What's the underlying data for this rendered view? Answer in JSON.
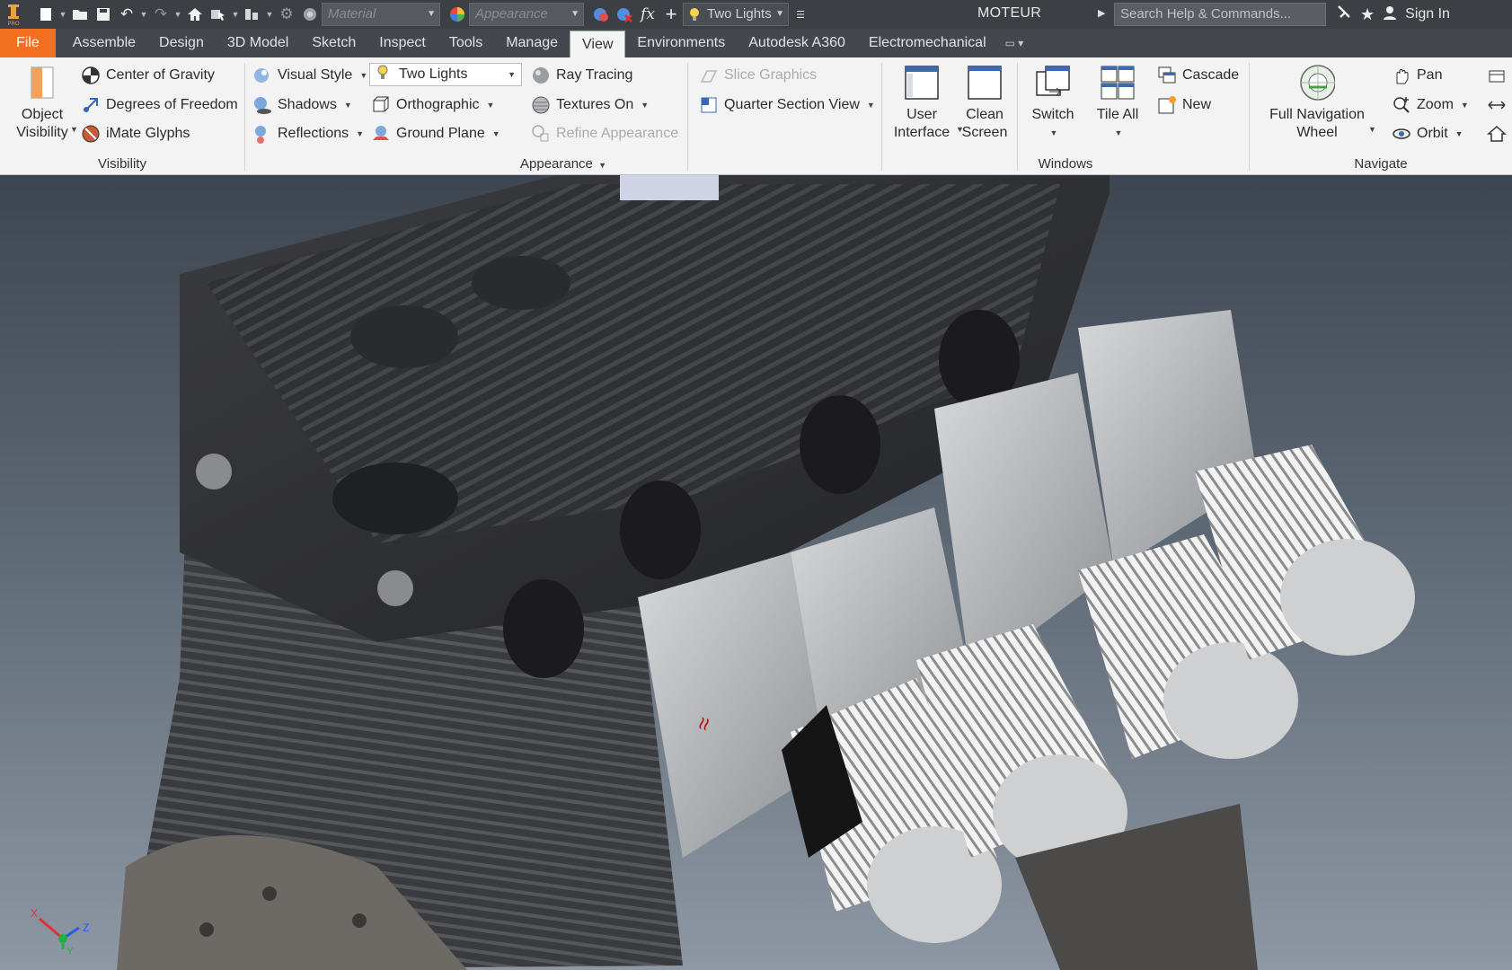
{
  "quick_access": {
    "material_placeholder": "Material",
    "appearance_placeholder": "Appearance",
    "lighting_value": "Two Lights"
  },
  "title_bar": {
    "document": "MOTEUR",
    "search_placeholder": "Search Help & Commands...",
    "sign_in": "Sign In"
  },
  "tabs": {
    "file": "File",
    "assemble": "Assemble",
    "design": "Design",
    "model3d": "3D Model",
    "sketch": "Sketch",
    "inspect": "Inspect",
    "tools": "Tools",
    "manage": "Manage",
    "view": "View",
    "environments": "Environments",
    "a360": "Autodesk A360",
    "electromechanical": "Electromechanical"
  },
  "ribbon": {
    "visibility": {
      "label": "Visibility",
      "object_visibility_1": "Object",
      "object_visibility_2": "Visibility",
      "center_of_gravity": "Center of Gravity",
      "degrees_of_freedom": "Degrees of Freedom",
      "imate_glyphs": "iMate Glyphs"
    },
    "appearance": {
      "label": "Appearance",
      "visual_style": "Visual Style",
      "shadows": "Shadows",
      "reflections": "Reflections",
      "two_lights": "Two Lights",
      "orthographic": "Orthographic",
      "ground_plane": "Ground Plane",
      "ray_tracing": "Ray Tracing",
      "textures_on": "Textures On",
      "refine_appearance": "Refine Appearance",
      "slice_graphics": "Slice Graphics",
      "quarter_section_view": "Quarter Section View"
    },
    "windows": {
      "label": "Windows",
      "user_interface_1": "User",
      "user_interface_2": "Interface",
      "clean_screen_1": "Clean",
      "clean_screen_2": "Screen",
      "switch": "Switch",
      "tile_all": "Tile All",
      "cascade": "Cascade",
      "new": "New"
    },
    "navigate": {
      "label": "Navigate",
      "full_nav_1": "Full Navigation",
      "full_nav_2": "Wheel",
      "pan": "Pan",
      "zoom": "Zoom",
      "orbit": "Orbit"
    }
  },
  "triad": {
    "x": "X",
    "y": "Y",
    "z": "Z"
  },
  "colors": {
    "file_tab": "#f37021",
    "title_bar": "#3c3f44",
    "ribbon": "#f3f3f3",
    "engine_dark": "#2f3033",
    "engine_light": "#c9cbcd"
  }
}
